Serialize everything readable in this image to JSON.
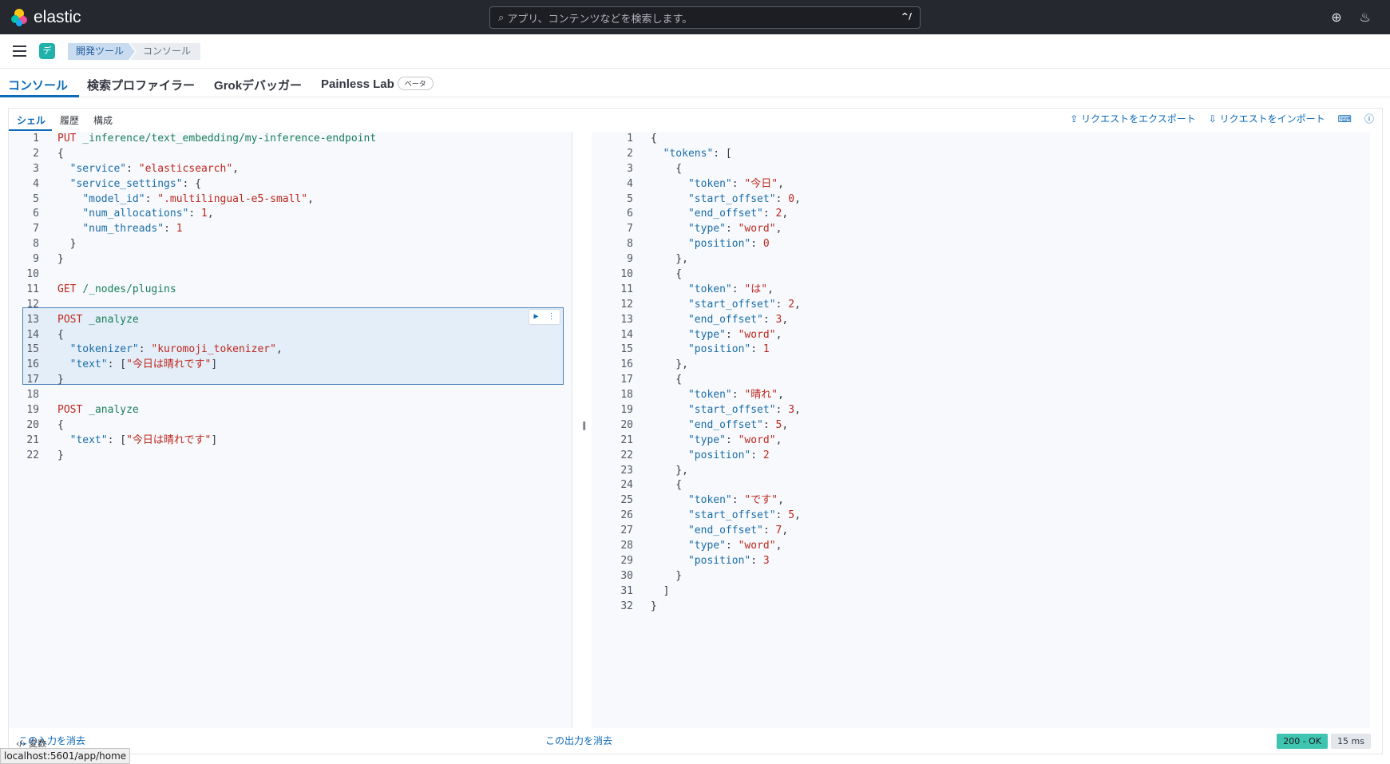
{
  "header": {
    "brand": "elastic",
    "search_placeholder": "アプリ、コンテンツなどを検索します。",
    "search_shortcut": "^/"
  },
  "subbar": {
    "app_badge": "デ",
    "breadcrumbs": [
      "開発ツール",
      "コンソール"
    ]
  },
  "tabs": [
    {
      "label": "コンソール",
      "active": true
    },
    {
      "label": "検索プロファイラー"
    },
    {
      "label": "Grokデバッガー"
    },
    {
      "label": "Painless Lab",
      "badge": "ベータ"
    }
  ],
  "shell_tabs": [
    "シェル",
    "履歴",
    "構成"
  ],
  "actions": {
    "export": "リクエストをエクスポート",
    "import": "リクエストをインポート"
  },
  "input_lines": [
    "PUT _inference/text_embedding/my-inference-endpoint",
    "{",
    "  \"service\": \"elasticsearch\",",
    "  \"service_settings\": {",
    "    \"model_id\": \".multilingual-e5-small\",",
    "    \"num_allocations\": 1,",
    "    \"num_threads\": 1",
    "  }",
    "}",
    "",
    "GET /_nodes/plugins",
    "",
    "POST _analyze",
    "{",
    "  \"tokenizer\": \"kuromoji_tokenizer\",",
    "  \"text\": [\"今日は晴れです\"]",
    "}",
    "",
    "POST _analyze",
    "{",
    "  \"text\": [\"今日は晴れです\"]",
    "}"
  ],
  "output_lines": [
    "{",
    "  \"tokens\": [",
    "    {",
    "      \"token\": \"今日\",",
    "      \"start_offset\": 0,",
    "      \"end_offset\": 2,",
    "      \"type\": \"word\",",
    "      \"position\": 0",
    "    },",
    "    {",
    "      \"token\": \"は\",",
    "      \"start_offset\": 2,",
    "      \"end_offset\": 3,",
    "      \"type\": \"word\",",
    "      \"position\": 1",
    "    },",
    "    {",
    "      \"token\": \"晴れ\",",
    "      \"start_offset\": 3,",
    "      \"end_offset\": 5,",
    "      \"type\": \"word\",",
    "      \"position\": 2",
    "    },",
    "    {",
    "      \"token\": \"です\",",
    "      \"start_offset\": 5,",
    "      \"end_offset\": 7,",
    "      \"type\": \"word\",",
    "      \"position\": 3",
    "    }",
    "  ]",
    "}"
  ],
  "footer": {
    "clear_input": "この入力を消去",
    "clear_output": "この出力を消去",
    "status": "200 - OK",
    "time": "15 ms",
    "variables": "変数",
    "url_hint": "localhost:5601/app/home"
  }
}
